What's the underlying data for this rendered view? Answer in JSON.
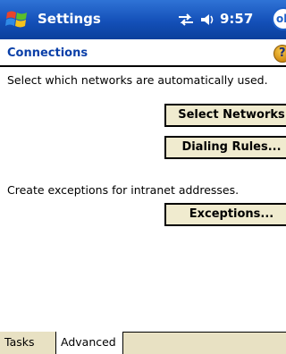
{
  "titlebar": {
    "title": "Settings",
    "time": "9:57",
    "ok_label": "ok",
    "start_icon": "windows-flag-icon",
    "connectivity_icon": "connectivity-arrows-icon",
    "volume_icon": "speaker-icon"
  },
  "header": {
    "title": "Connections",
    "help_icon": "help-icon"
  },
  "body": {
    "networks_text": "Select which networks are automatically used.",
    "select_networks_label": "Select Networks",
    "dialing_rules_label": "Dialing Rules...",
    "exceptions_text": "Create exceptions for intranet addresses.",
    "exceptions_label": "Exceptions..."
  },
  "tabs": [
    {
      "label": "Tasks"
    },
    {
      "label": "Advanced"
    }
  ],
  "colors": {
    "titlebar": "#1450b8",
    "header_title": "#0a3fa8",
    "button_face": "#f0ebcf",
    "tab_strip": "#e8e1c3"
  }
}
